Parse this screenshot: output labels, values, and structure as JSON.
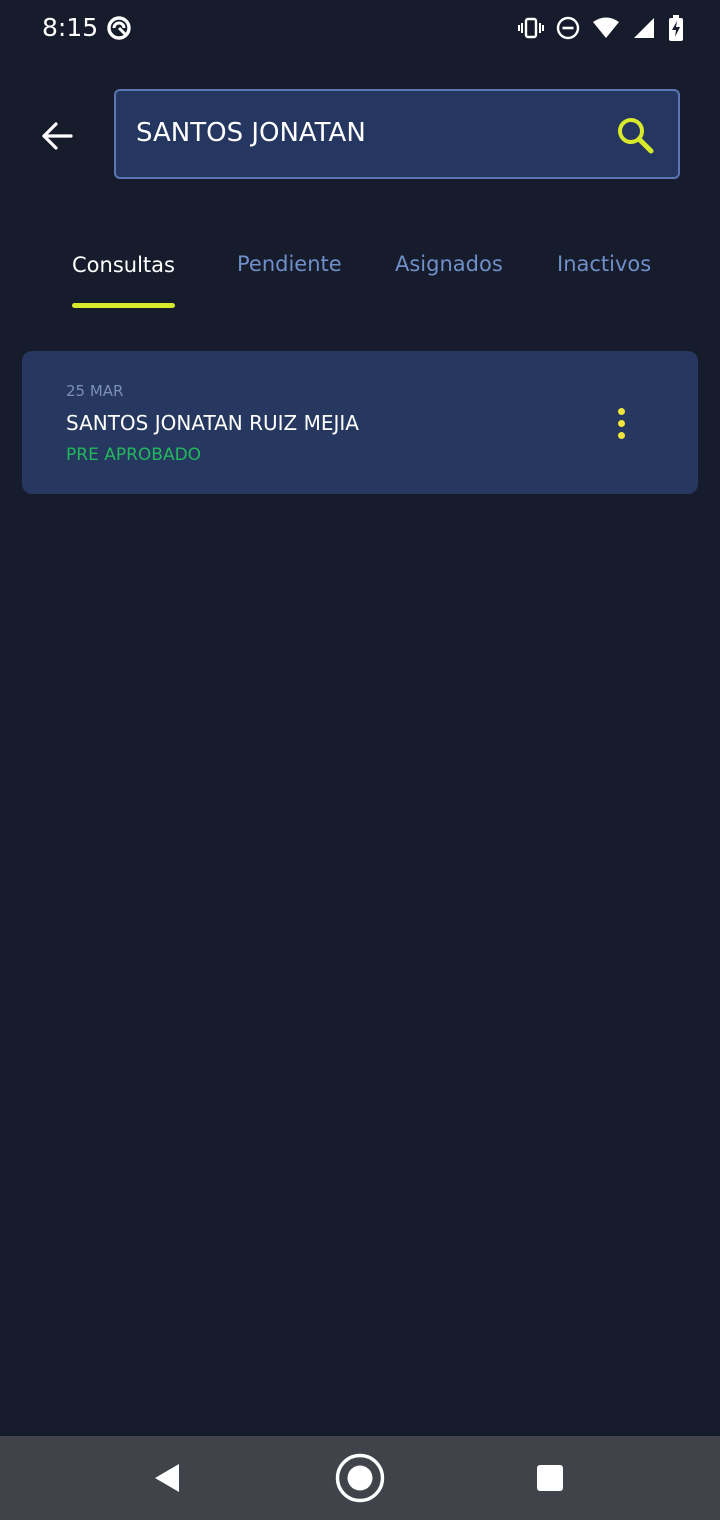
{
  "status_bar": {
    "time": "8:15"
  },
  "search": {
    "value": "SANTOS JONATAN",
    "back_icon": "arrow-left-icon",
    "search_icon": "search-icon"
  },
  "tabs": [
    {
      "label": "Consultas",
      "active": true
    },
    {
      "label": "Pendiente",
      "active": false
    },
    {
      "label": "Asignados",
      "active": false
    },
    {
      "label": "Inactivos",
      "active": false
    }
  ],
  "results": [
    {
      "date": "25 MAR",
      "name": "SANTOS JONATAN RUIZ MEJIA",
      "status": "PRE APROBADO",
      "menu_icon": "more-vertical-icon"
    }
  ],
  "colors": {
    "background": "#171c2c",
    "card": "#263760",
    "accent_yellow": "#d7e92a",
    "status_green": "#22b85d",
    "inactive_tab": "#6f8fc9"
  }
}
